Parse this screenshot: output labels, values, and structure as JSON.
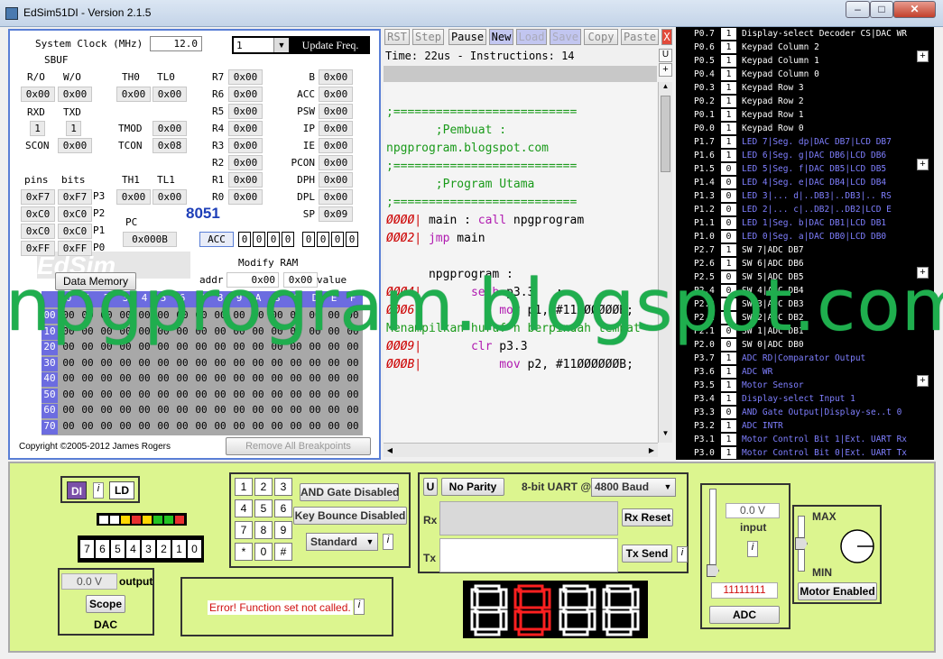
{
  "window": {
    "title": "EdSim51DI - Version 2.1.5"
  },
  "watermark": "npgprogram.blogspot.com",
  "registers": {
    "system_clock_label": "System Clock (MHz)",
    "system_clock_value": "12.0",
    "update_freq_value": "1",
    "update_freq_button": "Update Freq.",
    "sbuf": "SBUF",
    "ro": "R/O",
    "wo": "W/O",
    "ro_val": "0x00",
    "wo_val": "0x00",
    "rxd": "RXD",
    "txd": "TXD",
    "rxd_val": "1",
    "txd_val": "1",
    "scon": "SCON",
    "scon_val": "0x00",
    "th0": "TH0",
    "tl0": "TL0",
    "th0_val": "0x00",
    "tl0_val": "0x00",
    "tmod": "TMOD",
    "tmod_val": "0x00",
    "tcon": "TCON",
    "tcon_val": "0x08",
    "th1": "TH1",
    "tl1": "TL1",
    "th1_val": "0x00",
    "tl1_val": "0x00",
    "pins": "pins",
    "bits": "bits",
    "ports": [
      {
        "pin": "0xF7",
        "bit": "0xF7",
        "name": "P3"
      },
      {
        "pin": "0xC0",
        "bit": "0xC0",
        "name": "P2"
      },
      {
        "pin": "0xC0",
        "bit": "0xC0",
        "name": "P1"
      },
      {
        "pin": "0xFF",
        "bit": "0xFF",
        "name": "P0"
      }
    ],
    "rregs": [
      {
        "name": "R7",
        "val": "0x00"
      },
      {
        "name": "R6",
        "val": "0x00"
      },
      {
        "name": "R5",
        "val": "0x00"
      },
      {
        "name": "R4",
        "val": "0x00"
      },
      {
        "name": "R3",
        "val": "0x00"
      },
      {
        "name": "R2",
        "val": "0x00"
      },
      {
        "name": "R1",
        "val": "0x00"
      },
      {
        "name": "R0",
        "val": "0x00"
      }
    ],
    "sfrs": [
      {
        "name": "B",
        "val": "0x00"
      },
      {
        "name": "ACC",
        "val": "0x00"
      },
      {
        "name": "PSW",
        "val": "0x00"
      },
      {
        "name": "IP",
        "val": "0x00"
      },
      {
        "name": "IE",
        "val": "0x00"
      },
      {
        "name": "PCON",
        "val": "0x00"
      },
      {
        "name": "DPH",
        "val": "0x00"
      },
      {
        "name": "DPL",
        "val": "0x00"
      },
      {
        "name": "SP",
        "val": "0x09"
      }
    ],
    "pc": "PC",
    "pc_val": "0x000B",
    "chip": "8051",
    "acc_label": "ACC",
    "acc_bits_high": [
      "0",
      "0",
      "0",
      "0"
    ],
    "acc_bits_low": [
      "0",
      "0",
      "0",
      "0"
    ],
    "data_memory_button": "Data Memory",
    "modify_ram": "Modify RAM",
    "addr_label": "addr",
    "addr_val": "0x00",
    "value_label": "value",
    "value_val": "0x00",
    "mem_columns": [
      "0",
      "1",
      "2",
      "3",
      "4",
      "5",
      "6",
      "7",
      "8",
      "9",
      "A",
      "B",
      "C",
      "D",
      "E",
      "F"
    ],
    "mem_rows": [
      "00",
      "10",
      "20",
      "30",
      "40",
      "50",
      "60",
      "70"
    ],
    "mem_cell": "00",
    "copyright": "Copyright ©2005-2012 James Rogers",
    "remove_breakpoints": "Remove All Breakpoints"
  },
  "toolbar": {
    "rst": "RST",
    "step": "Step",
    "pause": "Pause",
    "new": "New",
    "load": "Load",
    "save": "Save",
    "copy": "Copy",
    "paste": "Paste",
    "x": "X",
    "u": "U",
    "plus": "+"
  },
  "status": "Time: 22us - Instructions: 14",
  "code": [
    {
      "text": ";==========================",
      "color": "#1a9a1a"
    },
    {
      "text": "       ;Pembuat :",
      "color": "#1a9a1a"
    },
    {
      "text": "npgprogram.blogspot.com",
      "color": "#1a9a1a"
    },
    {
      "text": ";==========================",
      "color": "#1a9a1a"
    },
    {
      "text": "       ;Program Utama",
      "color": "#1a9a1a"
    },
    {
      "text": ";==========================",
      "color": "#1a9a1a"
    },
    {
      "addr": "ØØØØ|",
      "text": " main : ",
      "kw": "call",
      "rest": " npgprogram"
    },
    {
      "addr": "ØØØ2|",
      "text": " ",
      "kw": "jmp",
      "rest": " main"
    },
    {
      "text": "",
      "color": "#000"
    },
    {
      "text": "      npgprogram :",
      "color": "#000"
    },
    {
      "addr": "ØØØ4|",
      "text": "       ",
      "kw": "setb",
      "rest": " p3.3   ;"
    },
    {
      "addr": "ØØØ6|",
      "text": "           ",
      "kw": "mov",
      "rest": " p1, #11ØØØØØØB;"
    },
    {
      "text": "Menampilkan huruf n berpindah tempat",
      "color": "#1a9a1a"
    },
    {
      "addr": "ØØØ9|",
      "text": "       ",
      "kw": "clr",
      "rest": " p3.3"
    },
    {
      "addr": "ØØØB|",
      "text": "           ",
      "kw": "mov",
      "rest": " p2, #11ØØØØØØB;"
    }
  ],
  "port_rows": [
    {
      "p": "P0.7",
      "b": "1",
      "d": "Display-select Decoder CS|DAC WR",
      "c": "#fff"
    },
    {
      "p": "P0.6",
      "b": "1",
      "d": "Keypad Column 2",
      "c": "#fff"
    },
    {
      "p": "P0.5",
      "b": "1",
      "d": "Keypad Column 1",
      "c": "#fff"
    },
    {
      "p": "P0.4",
      "b": "1",
      "d": "Keypad Column 0",
      "c": "#fff"
    },
    {
      "p": "P0.3",
      "b": "1",
      "d": "Keypad Row 3",
      "c": "#fff"
    },
    {
      "p": "P0.2",
      "b": "1",
      "d": "Keypad Row 2",
      "c": "#fff"
    },
    {
      "p": "P0.1",
      "b": "1",
      "d": "Keypad Row 1",
      "c": "#fff"
    },
    {
      "p": "P0.0",
      "b": "1",
      "d": "Keypad Row 0",
      "c": "#fff"
    },
    {
      "p": "P1.7",
      "b": "1",
      "d": "LED 7|Seg. dp|DAC DB7|LCD DB7",
      "c": "#7f7fff"
    },
    {
      "p": "P1.6",
      "b": "1",
      "d": "LED 6|Seg. g|DAC DB6|LCD DB6",
      "c": "#7f7fff"
    },
    {
      "p": "P1.5",
      "b": "0",
      "d": "LED 5|Seg. f|DAC DB5|LCD DB5",
      "c": "#7f7fff"
    },
    {
      "p": "P1.4",
      "b": "0",
      "d": "LED 4|Seg. e|DAC DB4|LCD DB4",
      "c": "#7f7fff"
    },
    {
      "p": "P1.3",
      "b": "0",
      "d": "LED 3|... d|..DB3|..DB3|.. RS",
      "c": "#7f7fff"
    },
    {
      "p": "P1.2",
      "b": "0",
      "d": "LED 2|... c|..DB2|..DB2|LCD E",
      "c": "#7f7fff"
    },
    {
      "p": "P1.1",
      "b": "0",
      "d": "LED 1|Seg. b|DAC DB1|LCD DB1",
      "c": "#7f7fff"
    },
    {
      "p": "P1.0",
      "b": "0",
      "d": "LED 0|Seg. a|DAC DB0|LCD DB0",
      "c": "#7f7fff"
    },
    {
      "p": "P2.7",
      "b": "1",
      "d": "SW 7|ADC DB7",
      "c": "#fff"
    },
    {
      "p": "P2.6",
      "b": "1",
      "d": "SW 6|ADC DB6",
      "c": "#fff"
    },
    {
      "p": "P2.5",
      "b": "0",
      "d": "SW 5|ADC DB5",
      "c": "#fff"
    },
    {
      "p": "P2.4",
      "b": "0",
      "d": "SW 4|ADC DB4",
      "c": "#fff"
    },
    {
      "p": "P2.3",
      "b": "0",
      "d": "SW 3|ADC DB3",
      "c": "#fff"
    },
    {
      "p": "P2.2",
      "b": "0",
      "d": "SW 2|ADC DB2",
      "c": "#fff"
    },
    {
      "p": "P2.1",
      "b": "0",
      "d": "SW 1|ADC DB1",
      "c": "#fff"
    },
    {
      "p": "P2.0",
      "b": "0",
      "d": "SW 0|ADC DB0",
      "c": "#fff"
    },
    {
      "p": "P3.7",
      "b": "1",
      "d": "ADC RD|Comparator Output",
      "c": "#7f7fff"
    },
    {
      "p": "P3.6",
      "b": "1",
      "d": "ADC WR",
      "c": "#7f7fff"
    },
    {
      "p": "P3.5",
      "b": "1",
      "d": "Motor Sensor",
      "c": "#7f7fff"
    },
    {
      "p": "P3.4",
      "b": "1",
      "d": "Display-select Input 1",
      "c": "#7f7fff"
    },
    {
      "p": "P3.3",
      "b": "0",
      "d": "AND Gate Output|Display-se..t 0",
      "c": "#7f7fff"
    },
    {
      "p": "P3.2",
      "b": "1",
      "d": "ADC INTR",
      "c": "#7f7fff"
    },
    {
      "p": "P3.1",
      "b": "1",
      "d": "Motor Control Bit 1|Ext. UART Rx",
      "c": "#7f7fff"
    },
    {
      "p": "P3.0",
      "b": "1",
      "d": "Motor Control Bit 0|Ext. UART Tx",
      "c": "#7f7fff"
    }
  ],
  "bottom": {
    "di": "DI",
    "i": "i",
    "ld": "LD",
    "led_colors": [
      "#ffffff",
      "#ffffff",
      "#ffd800",
      "#e83030",
      "#ffd800",
      "#23c423",
      "#23c423",
      "#e83030"
    ],
    "switch_labels": [
      "7",
      "6",
      "5",
      "4",
      "3",
      "2",
      "1",
      "0"
    ],
    "dac_value": "0.0 V",
    "dac_output": "output",
    "scope": "Scope",
    "dac": "DAC",
    "keys": [
      "1",
      "2",
      "3",
      "4",
      "5",
      "6",
      "7",
      "8",
      "9",
      "*",
      "0",
      "#"
    ],
    "and_gate": "AND Gate Disabled",
    "key_bounce": "Key Bounce Disabled",
    "standard": "Standard",
    "lcd_error": "Error! Function set not called.",
    "uart_u": "U",
    "no_parity": "No Parity",
    "uart_mode": "8-bit UART @",
    "baud": "4800 Baud",
    "rx": "Rx",
    "tx": "Tx",
    "rx_reset": "Rx Reset",
    "tx_send": "Tx Send",
    "adc_value": "0.0 V",
    "adc_input": "input",
    "adc_bits": "11111111",
    "adc": "ADC",
    "max": "MAX",
    "min": "MIN",
    "motor_enabled": "Motor Enabled"
  }
}
